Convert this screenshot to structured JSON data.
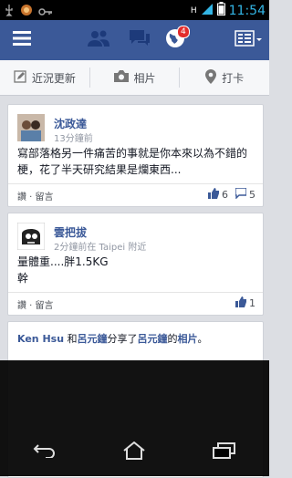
{
  "statusbar": {
    "time": "11:54",
    "network": "H"
  },
  "topbar": {
    "notification_count": "4"
  },
  "actions": {
    "status": "近況更新",
    "photo": "相片",
    "checkin": "打卡"
  },
  "posts": [
    {
      "author": "沈政達",
      "time": "13分鐘前",
      "text_line1": "寫部落格另一件痛苦的事就是你本來以為不錯的",
      "text_line2": "梗，花了半天研究結果是爛東西...",
      "footer": "讚 · 留言",
      "likes": "6",
      "comments": "5"
    },
    {
      "author": "雲把拔",
      "time": "2分鐘前在 Taipei 附近",
      "text_line1": "量體重....胖1.5KG",
      "text_line2": "幹",
      "footer": "讚 · 留言",
      "likes": "1"
    }
  ],
  "share": {
    "user": "Ken Hsu",
    "connector1": "和",
    "friend": "呂元鐘",
    "connector2": "分享了",
    "owner": "呂元鐘",
    "connector3": "的",
    "item": "相片",
    "end": "。"
  },
  "colors": {
    "brand": "#3b5998",
    "badge": "#e32c2c",
    "clock": "#33b5e5"
  }
}
